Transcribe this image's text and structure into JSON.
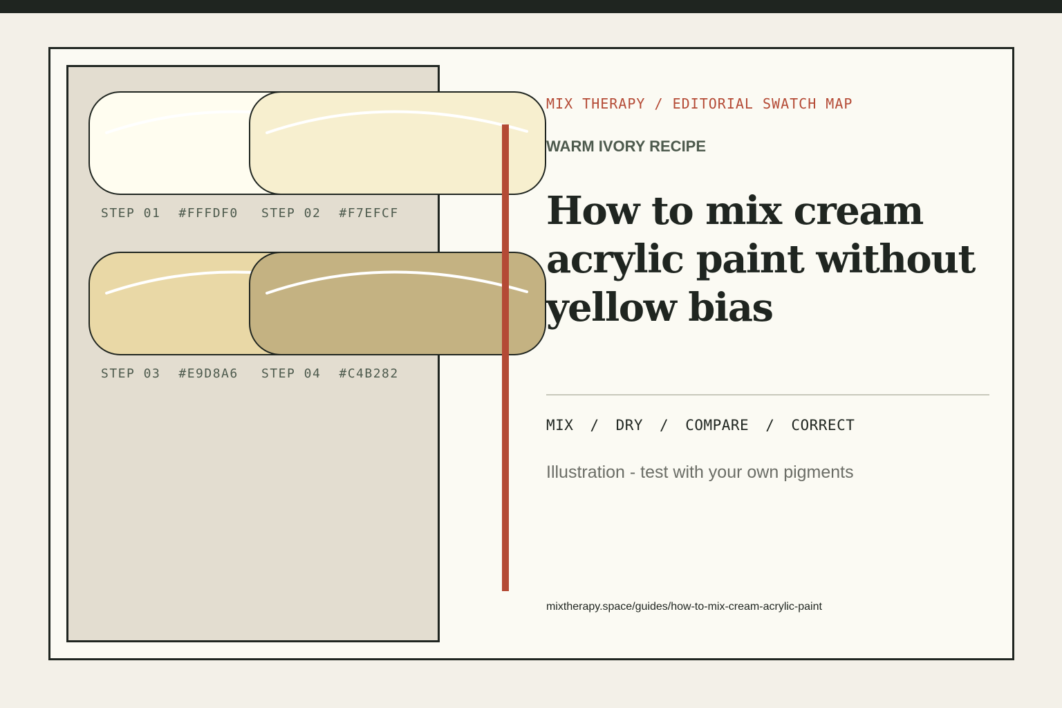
{
  "header": {
    "eyebrow": "MIX THERAPY / EDITORIAL SWATCH MAP",
    "kicker": "WARM IVORY RECIPE",
    "title": "How to mix cream acrylic paint without yellow bias"
  },
  "swatches": [
    {
      "step": "STEP 01",
      "hex": "#FFFDF0",
      "color": "#fffdf0"
    },
    {
      "step": "STEP 02",
      "hex": "#F7EFCF",
      "color": "#f7efcf"
    },
    {
      "step": "STEP 03",
      "hex": "#E9D8A6",
      "color": "#e9d8a6"
    },
    {
      "step": "STEP 04",
      "hex": "#C4B282",
      "color": "#c4b282"
    }
  ],
  "process": {
    "steps": [
      "MIX",
      "DRY",
      "COMPARE",
      "CORRECT"
    ],
    "separator": "/"
  },
  "note": "Illustration - test with your own pigments",
  "url": "mixtherapy.space/guides/how-to-mix-cream-acrylic-paint",
  "colors": {
    "ink": "#1f2520",
    "accent": "#b44a35",
    "paper": "#fbfaf3",
    "panel": "#e3ddd0",
    "muted": "#4d5a4d"
  }
}
